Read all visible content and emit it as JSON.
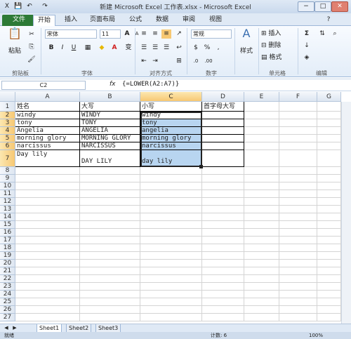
{
  "window": {
    "title": "新建 Microsoft Excel 工作表.xlsx - Microsoft Excel",
    "minimize": "−",
    "maximize": "□",
    "close": "✕"
  },
  "quick_access": [
    "💾",
    "↶",
    "↷"
  ],
  "tabs": [
    "文件",
    "开始",
    "插入",
    "页面布局",
    "公式",
    "数据",
    "审阅",
    "视图"
  ],
  "ribbon": {
    "clipboard": {
      "label": "剪贴板",
      "paste": "粘贴"
    },
    "font": {
      "label": "字体",
      "font_name": "宋体",
      "font_size": "11",
      "bold": "B",
      "italic": "I",
      "underline": "U",
      "grow": "A",
      "shrink": "A",
      "color": "A",
      "phonetic": "变"
    },
    "alignment": {
      "label": "对齐方式"
    },
    "number": {
      "label": "数字",
      "format": "常规",
      "percent": "%",
      "comma": ",",
      "currency": "$"
    },
    "styles": {
      "label": "",
      "button": "样式"
    },
    "cells": {
      "label": "单元格",
      "insert": "插入",
      "delete": "删除",
      "format": "格式"
    },
    "editing": {
      "label": "编辑",
      "sum": "Σ",
      "fill": "↓",
      "clear": "◈"
    }
  },
  "formula_bar": {
    "name_box": "C2",
    "fx": "fx",
    "formula": "{=LOWER(A2:A7)}"
  },
  "columns": [
    "A",
    "B",
    "C",
    "D",
    "E",
    "F",
    "G"
  ],
  "rows": [
    "1",
    "2",
    "3",
    "4",
    "5",
    "6",
    "7",
    "8",
    "9",
    "10",
    "11",
    "12",
    "13",
    "14",
    "15",
    "16",
    "17",
    "18",
    "19",
    "20",
    "21",
    "22",
    "23",
    "24",
    "25",
    "26",
    "27"
  ],
  "table": {
    "r1": [
      "姓名",
      "大写",
      "小写",
      "首字母大写"
    ],
    "r2": [
      "windy",
      "WINDY",
      "windy",
      ""
    ],
    "r3": [
      "tony",
      "TONY",
      "tony",
      ""
    ],
    "r4": [
      "Angelia",
      "ANGELIA",
      "angelia",
      ""
    ],
    "r5": [
      "morning glory",
      "MORNING GLORY",
      "morning glory",
      ""
    ],
    "r6": [
      "narcissus",
      "NARCISSUS",
      "narcissus",
      ""
    ],
    "r7": [
      "Day lily",
      "DAY LILY",
      "day lily",
      ""
    ]
  },
  "sheets": [
    "Sheet1",
    "Sheet2",
    "Sheet3"
  ],
  "status": {
    "left": "就绪",
    "count": "计数: 6",
    "zoom": "100%"
  },
  "colors": {
    "file_tab": "#2d7a36",
    "selection": "#b8d5f0",
    "header_selected": "#f7c873"
  }
}
